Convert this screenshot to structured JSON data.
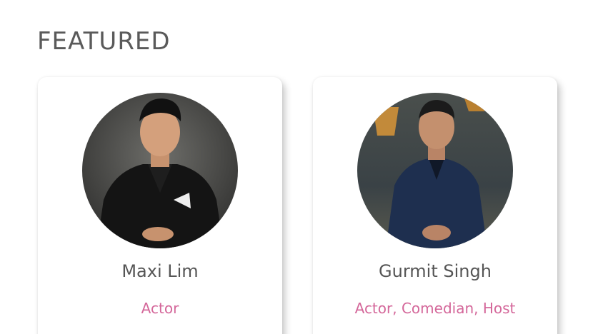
{
  "section": {
    "title": "FEATURED"
  },
  "colors": {
    "role_accent": "#d4679a",
    "name_text": "#555555",
    "title_text": "#5a5a5a"
  },
  "cards": [
    {
      "name": "Maxi Lim",
      "role": "Actor",
      "photo_icon": "portrait-photo"
    },
    {
      "name": "Gurmit Singh",
      "role": "Actor, Comedian, Host",
      "photo_icon": "portrait-photo"
    }
  ]
}
